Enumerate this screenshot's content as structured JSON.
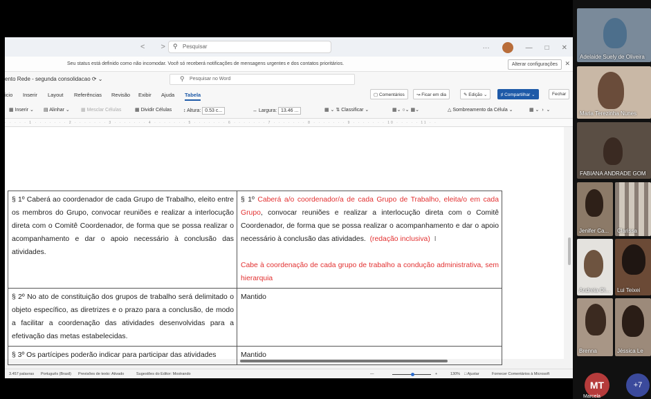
{
  "titlebar": {
    "search_placeholder": "Pesquisar",
    "nav": "< >"
  },
  "notification": {
    "message": "Seu status está definido como não incomodar. Você só receberá notificações de mensagens urgentes e dos contatos prioritários.",
    "button": "Alterar configurações"
  },
  "docbar": {
    "doc_name": "ento Rede - segunda consolidacao",
    "search_placeholder": "Pesquisar no Word"
  },
  "ribbon": {
    "tabs": [
      "icio",
      "Inserir",
      "Layout",
      "Referências",
      "Revisão",
      "Exibir",
      "Ajuda",
      "Tabela"
    ],
    "comments": "Comentários",
    "catch_up": "Ficar em dia",
    "editing": "Edição",
    "share": "Compartilhar",
    "close": "Fechar"
  },
  "toolbar": {
    "insert": "Inserir",
    "align": "Alinhar",
    "merge": "Mesclar Células",
    "split": "Dividir Células",
    "height_label": "Altura:",
    "height_value": "0.53 c...",
    "width_label": "Largura:",
    "width_value": "13.46 ...",
    "sort": "Classificar",
    "shading": "Sombreamento da Célula"
  },
  "table": {
    "rows": [
      {
        "left": "§ 1º Caberá ao coordenador de cada Grupo de Trabalho, eleito entre os membros do Grupo, convocar reuniões e realizar a interlocução direta com o Comitê Coordenador, de forma que se possa realizar o acompanhamento e dar o apoio necessário à conclusão das atividades.",
        "right_prefix": "§ 1º ",
        "right_red": "Caberá a/o coordenador/a de cada Grupo de Trabalho, eleita/o em cada Grupo",
        "right_black": ", convocar reuniões e realizar a interlocução direta com o Comitê Coordenador, de forma que se possa realizar o acompanhamento e dar o apoio necessário à conclusão das atividades.",
        "right_tag": "(redação inclusiva)",
        "right_extra": "Cabe à coordenação de cada grupo de trabalho a condução administrativa, sem hierarquia"
      },
      {
        "left": "§ 2º No ato de constituição dos grupos de trabalho será delimitado o objeto específico, as diretrizes e o prazo para a conclusão, de modo a facilitar a coordenação das atividades desenvolvidas para a efetivação das metas estabelecidas.",
        "right": "Mantido"
      },
      {
        "left": "§ 3º Os partícipes poderão indicar para participar das atividades",
        "right": "Mantido"
      }
    ]
  },
  "statusbar": {
    "words": "3.457 palavras",
    "language": "Português (Brasil)",
    "predictions": "Previsões de texto: Ativado",
    "editor": "Sugestões do Editor: Mostrando",
    "zoom": "130%",
    "fit": "Ajustar",
    "feedback": "Fornecer Comentários à Microsoft"
  },
  "participants": [
    {
      "name": "Adelaide Suely de Oliveira",
      "bg": "#7a8a9a"
    },
    {
      "name": "Maria Terezinha Nunes",
      "bg": "#c9b8a6"
    },
    {
      "name": "FABIANA ANDRADE GOM",
      "bg": "#5a4e44"
    },
    {
      "name": "Jenifer Ca...",
      "bg": "#8c7a68"
    },
    {
      "name": "Clarissa",
      "bg": "#d8d2c8"
    },
    {
      "name": "Andreia Ol...",
      "bg": "#e4e2de"
    },
    {
      "name": "Lui Teixei",
      "bg": "#6b4a36"
    },
    {
      "name": "Brenna",
      "bg": "#a89686"
    },
    {
      "name": "Jéssica Le",
      "bg": "#9c8a7a"
    }
  ],
  "presence": {
    "initials": "MT",
    "name": "Marcela",
    "more": "+7"
  }
}
